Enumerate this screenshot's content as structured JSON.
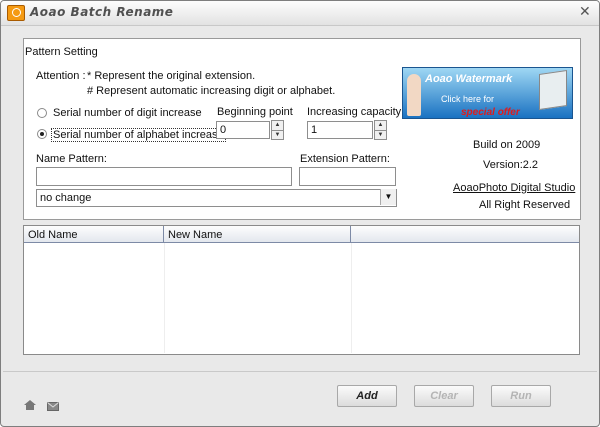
{
  "window": {
    "title": "Aoao Batch Rename",
    "close_glyph": "✕"
  },
  "pattern": {
    "group_label": "Pattern Setting",
    "attention_label": "Attention :",
    "attention_line1": "* Represent the original extension.",
    "attention_line2": "# Represent automatic increasing digit or alphabet.",
    "radio_digit": "Serial number of digit increase",
    "radio_alpha": "Serial number of alphabet increase",
    "selected_radio": "alphabet",
    "beginning_label": "Beginning point",
    "beginning_value": "0",
    "increasing_label": "Increasing capacity",
    "increasing_value": "1",
    "name_pattern_label": "Name Pattern:",
    "name_pattern_value": "",
    "extension_pattern_label": "Extension Pattern:",
    "extension_pattern_value": "",
    "case_select_value": "no change"
  },
  "ad": {
    "title": "Aoao Watermark",
    "line2": "Click here for",
    "line3": "special offer"
  },
  "info": {
    "build": "Build on 2009",
    "version": "Version:2.2",
    "studio_link": "AoaoPhoto Digital Studio",
    "rights": "All Right Reserved"
  },
  "list": {
    "columns": [
      "Old Name",
      "New Name",
      ""
    ]
  },
  "buttons": {
    "add": "Add",
    "clear": "Clear",
    "run": "Run"
  },
  "colors": {
    "accent": "#f59a12",
    "ad_blue": "#1a72c2",
    "ad_red": "#e01b1b"
  }
}
